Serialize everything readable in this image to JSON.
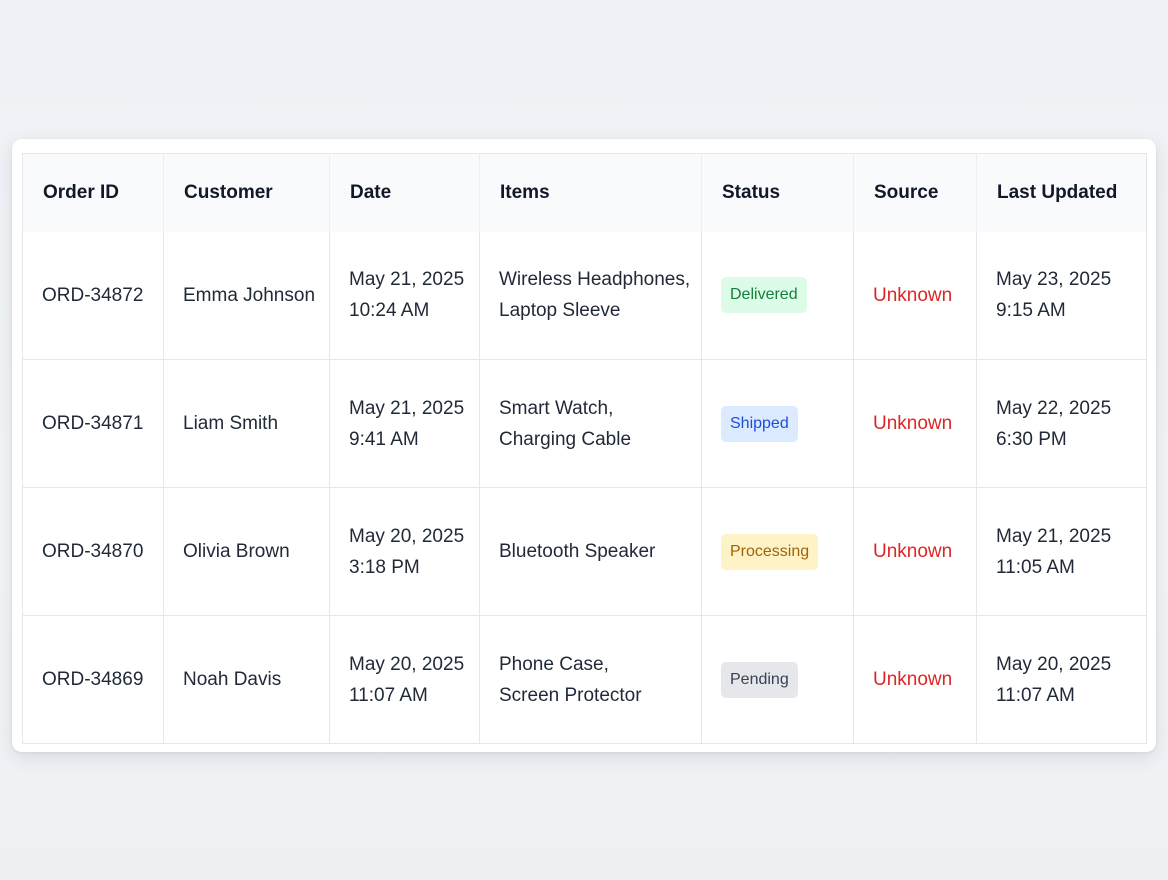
{
  "table": {
    "headers": [
      "Order ID",
      "Customer",
      "Date",
      "Items",
      "Status",
      "Source",
      "Last Updated"
    ],
    "rows": [
      {
        "order_id": "ORD-34872",
        "customer": "Emma Johnson",
        "date": [
          "May 21, 2025",
          "10:24 AM"
        ],
        "items": [
          "Wireless Headphones,",
          "Laptop Sleeve"
        ],
        "status": "Delivered",
        "status_bg": "#dcfce7",
        "status_color": "#15803d",
        "source": "Unknown",
        "last_updated": [
          "May 23, 2025",
          "9:15 AM"
        ]
      },
      {
        "order_id": "ORD-34871",
        "customer": "Liam Smith",
        "date": [
          "May 21, 2025",
          "9:41 AM"
        ],
        "items": [
          "Smart Watch,",
          "Charging Cable"
        ],
        "status": "Shipped",
        "status_bg": "#dbeafe",
        "status_color": "#1d4ed8",
        "source": "Unknown",
        "last_updated": [
          "May 22, 2025",
          "6:30 PM"
        ]
      },
      {
        "order_id": "ORD-34870",
        "customer": "Olivia Brown",
        "date": [
          "May 20, 2025",
          "3:18 PM"
        ],
        "items": [
          "Bluetooth Speaker"
        ],
        "status": "Processing",
        "status_bg": "#fef3c7",
        "status_color": "#a16207",
        "source": "Unknown",
        "last_updated": [
          "May 21, 2025",
          "11:05 AM"
        ]
      },
      {
        "order_id": "ORD-34869",
        "customer": "Noah Davis",
        "date": [
          "May 20, 2025",
          "11:07 AM"
        ],
        "items": [
          "Phone Case,",
          "Screen Protector"
        ],
        "status": "Pending",
        "status_bg": "#e5e7eb",
        "status_color": "#374151",
        "source": "Unknown",
        "last_updated": [
          "May 20, 2025",
          "11:07 AM"
        ]
      }
    ]
  },
  "colors": {
    "source_unknown": "#dc2626"
  }
}
